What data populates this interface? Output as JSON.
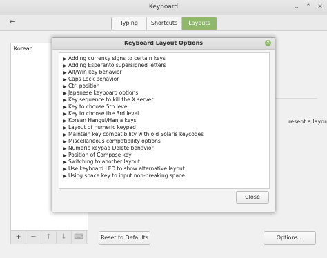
{
  "window": {
    "title": "Keyboard",
    "back_glyph": "←",
    "minimize_glyph": "⌄",
    "maximize_glyph": "⌃",
    "close_glyph": "✕"
  },
  "tabs": [
    {
      "label": "Typing",
      "active": false
    },
    {
      "label": "Shortcuts",
      "active": false
    },
    {
      "label": "Layouts",
      "active": true
    }
  ],
  "layouts_list": {
    "items": [
      "Korean"
    ],
    "toolbar": [
      {
        "name": "add-layout-button",
        "glyph": "+",
        "enabled": true
      },
      {
        "name": "remove-layout-button",
        "glyph": "−",
        "enabled": true
      },
      {
        "name": "move-up-button",
        "glyph": "↑",
        "enabled": false
      },
      {
        "name": "move-down-button",
        "glyph": "↓",
        "enabled": false
      },
      {
        "name": "show-layout-button",
        "glyph": "⌨",
        "enabled": false
      }
    ]
  },
  "background": {
    "partial_text": "resent a layout",
    "reset_label": "Reset to Defaults",
    "options_label": "Options..."
  },
  "dialog": {
    "title": "Keyboard Layout Options",
    "expander_glyph": "▶",
    "close_glyph": "✕",
    "options": [
      "Adding currency signs to certain keys",
      "Adding Esperanto supersigned letters",
      "Alt/Win key behavior",
      "Caps Lock behavior",
      "Ctrl position",
      "Japanese keyboard options",
      "Key sequence to kill the X server",
      "Key to choose 5th level",
      "Key to choose the 3rd level",
      "Korean Hangul/Hanja keys",
      "Layout of numeric keypad",
      "Maintain key compatibility with old Solaris keycodes",
      "Miscellaneous compatibility options",
      "Numeric keypad Delete behavior",
      "Position of Compose key",
      "Switching to another layout",
      "Use keyboard LED to show alternative layout",
      "Using space key to input non-breaking space"
    ],
    "close_label": "Close"
  },
  "colors": {
    "accent": "#8fb86a",
    "backdrop": "#3b3b3b"
  }
}
